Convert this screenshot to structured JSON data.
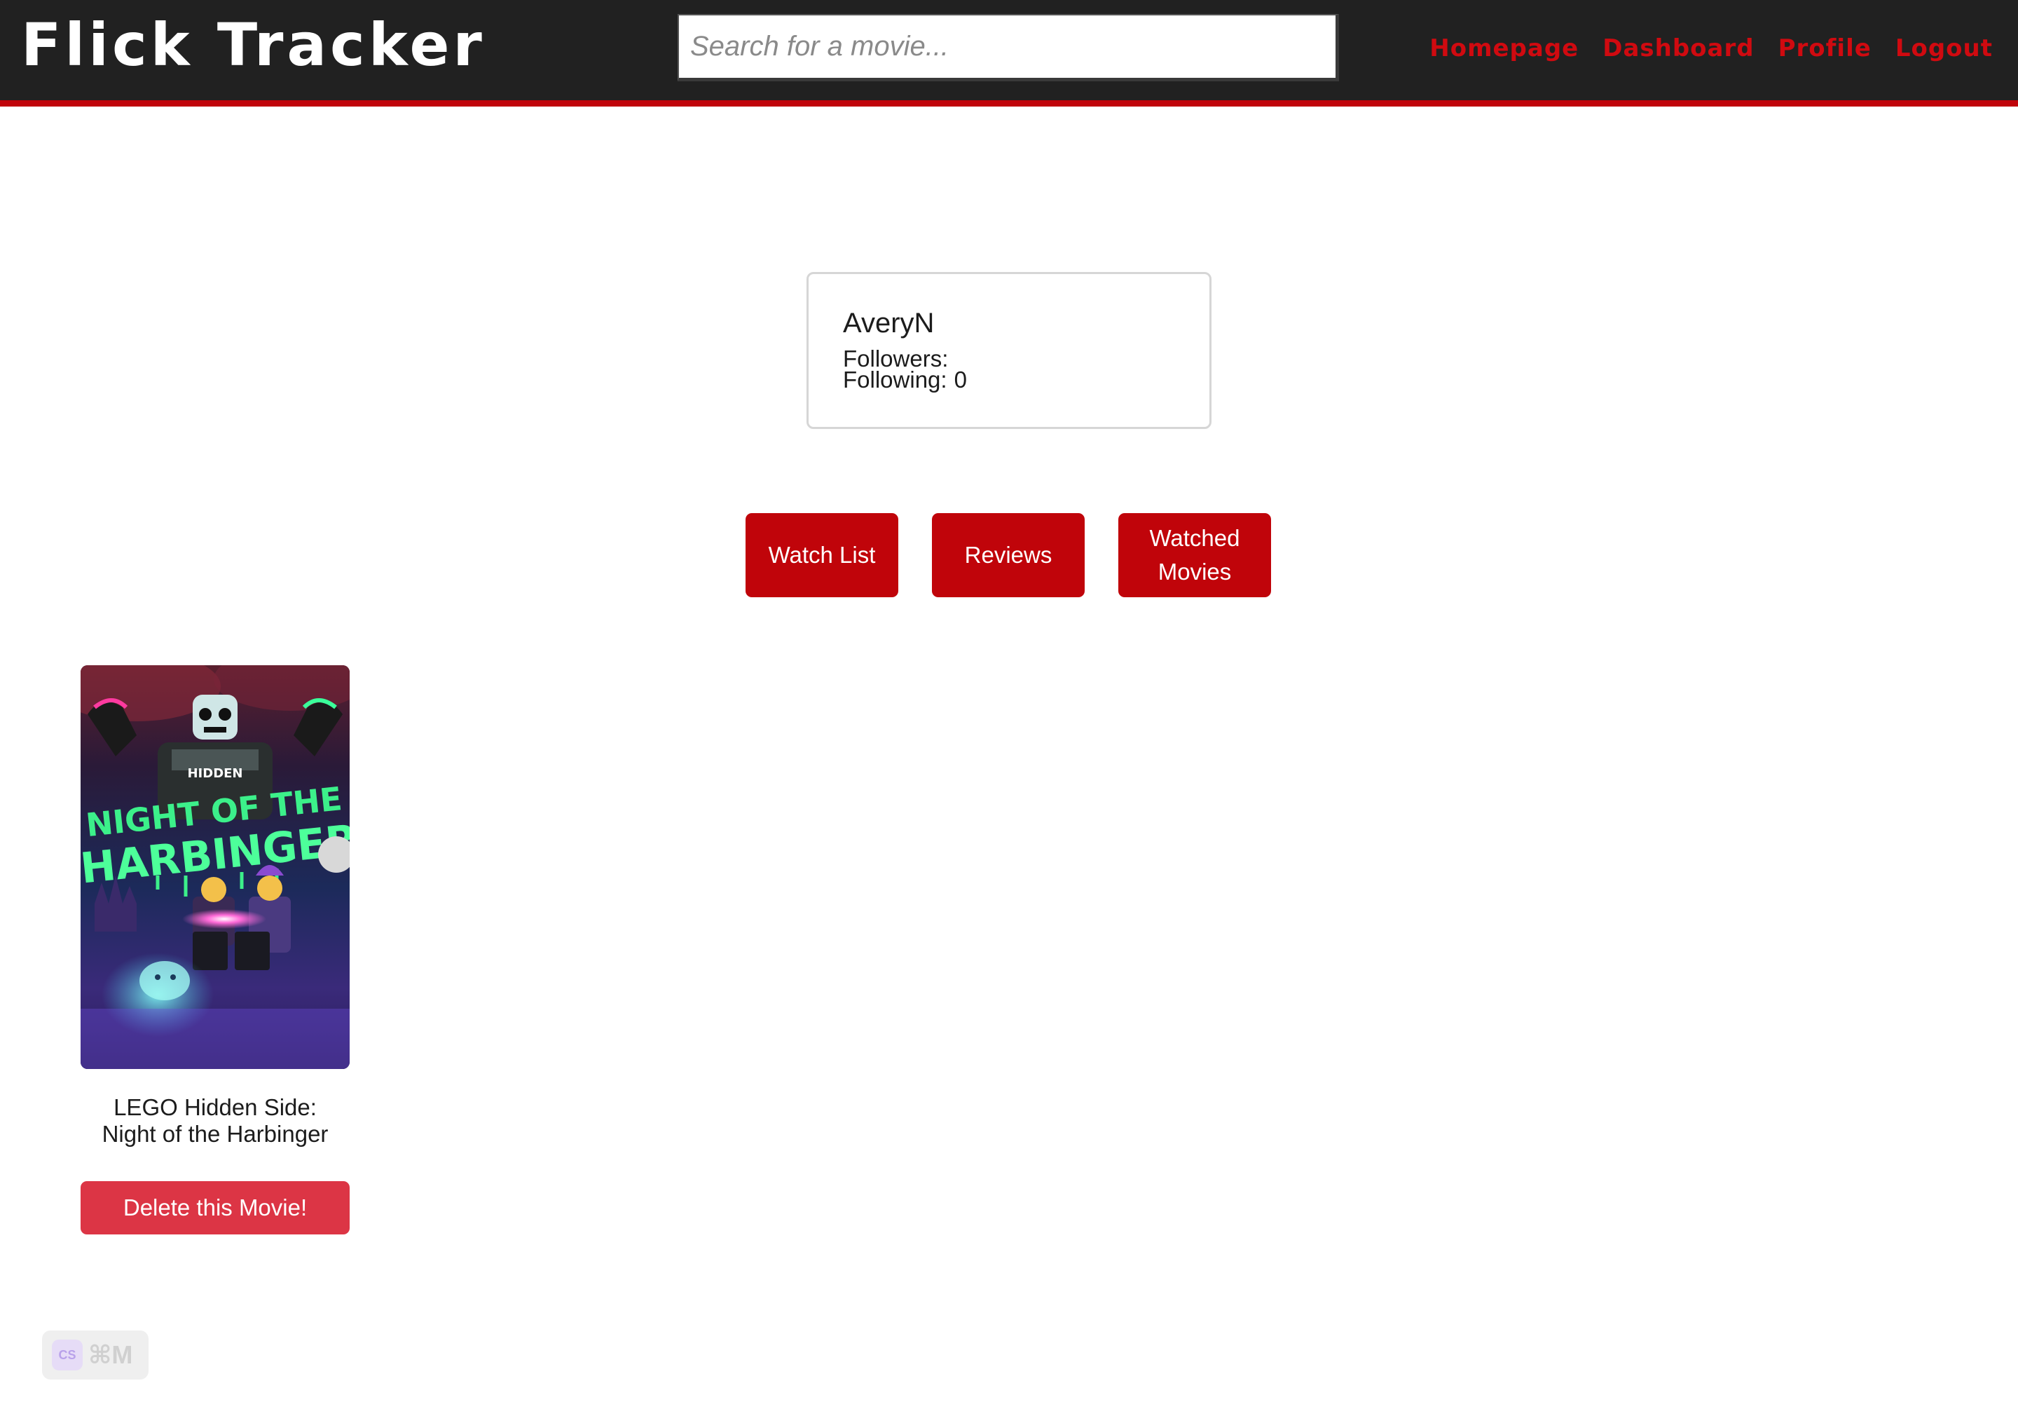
{
  "header": {
    "brand": "Flick Tracker",
    "search_placeholder": "Search for a movie...",
    "nav": [
      "Homepage",
      "Dashboard",
      "Profile",
      "Logout"
    ]
  },
  "profile": {
    "username": "AveryN",
    "followers_label": "Followers:",
    "followers_value": "",
    "following_label": "Following:",
    "following_value": "0"
  },
  "tabs": [
    "Watch List",
    "Reviews",
    "Watched Movies"
  ],
  "movies": [
    {
      "title": "LEGO Hidden Side: Night of the Harbinger",
      "poster_text_top": "HIDDEN",
      "poster_text_main": "NIGHT OF THE HARBINGER",
      "delete_label": "Delete this Movie!"
    }
  ],
  "shortcut": {
    "logo": "CS",
    "keys": "⌘M"
  },
  "colors": {
    "header_bg": "#212121",
    "accent_red": "#c0040a",
    "nav_red": "#d00a10",
    "delete_red": "#dc3545"
  }
}
